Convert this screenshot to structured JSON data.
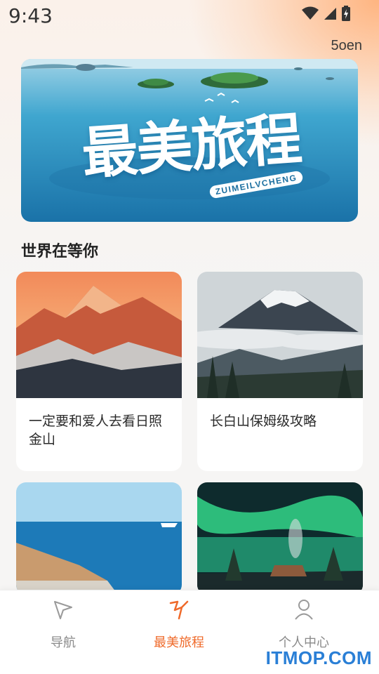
{
  "status_bar": {
    "time": "9:43"
  },
  "header": {
    "user_tag": "5oen"
  },
  "banner": {
    "title": "最美旅程",
    "subtitle": "ZUIMEILVCHENG"
  },
  "section": {
    "title": "世界在等你"
  },
  "cards": [
    {
      "title": "一定要和爱人去看日照金山",
      "image": "golden-sunrise-mountain"
    },
    {
      "title": "长白山保姆级攻略",
      "image": "snowy-volcano-clouds"
    },
    {
      "title": "",
      "image": "seaside-boardwalk"
    },
    {
      "title": "",
      "image": "aurora-cabin"
    }
  ],
  "bottom_nav": {
    "items": [
      {
        "label": "导航",
        "icon": "navigation-icon",
        "active": false
      },
      {
        "label": "最美旅程",
        "icon": "journey-icon",
        "active": true
      },
      {
        "label": "个人中心",
        "icon": "user-icon",
        "active": false
      }
    ]
  },
  "watermark": "ITMOP.COM",
  "colors": {
    "accent": "#ef6a2a",
    "inactive": "#8a8a8a",
    "watermark": "#2a7fd6"
  }
}
